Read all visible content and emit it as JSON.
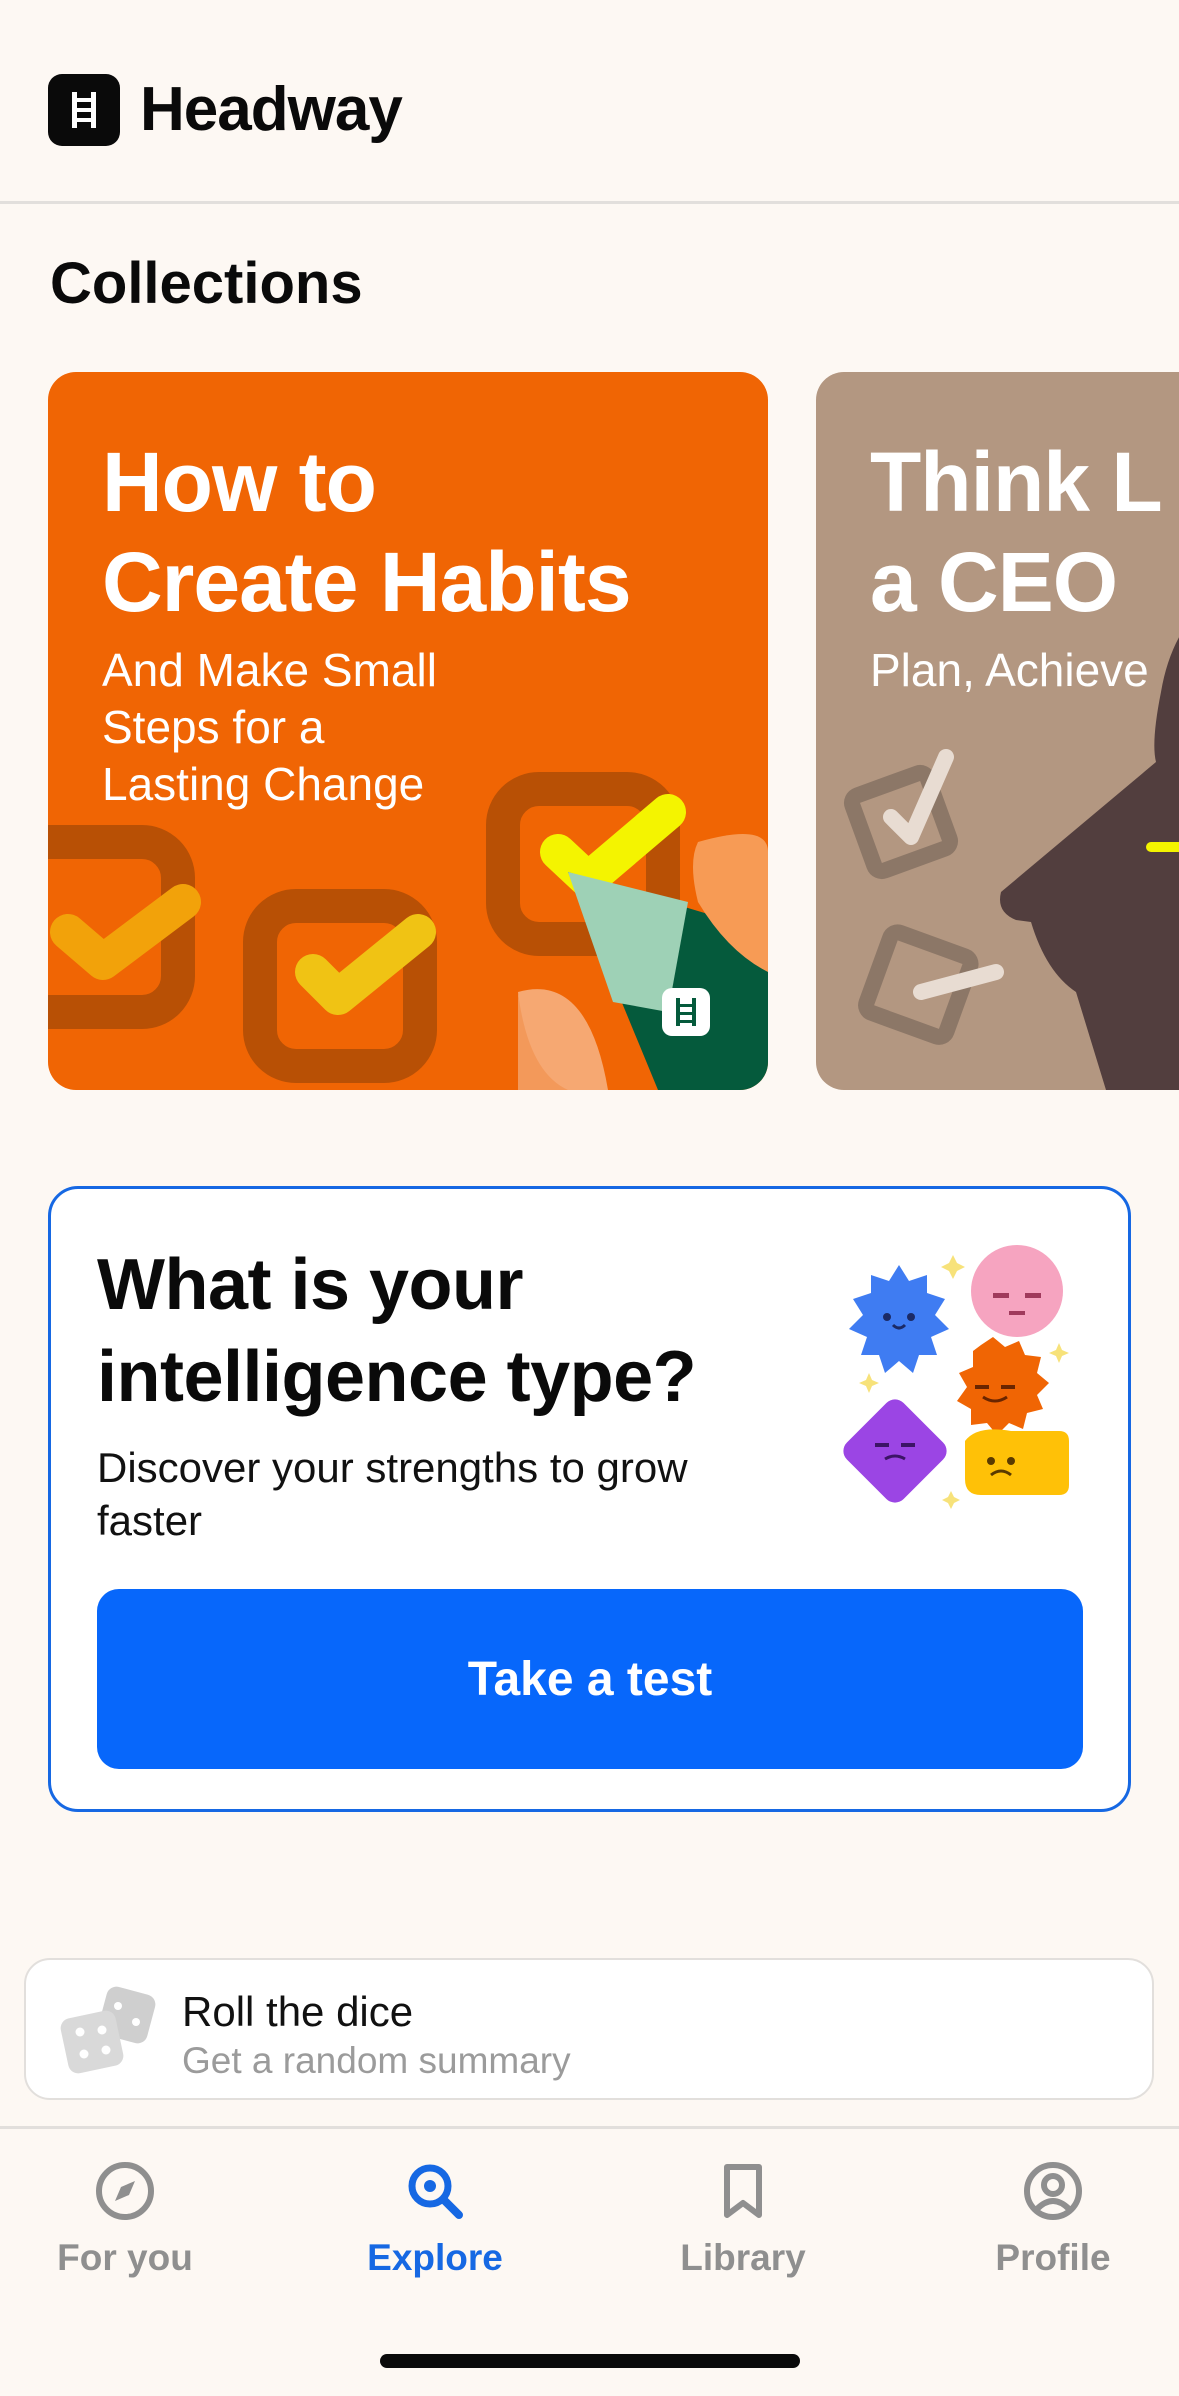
{
  "app": {
    "name": "Headway"
  },
  "collections": {
    "title": "Collections",
    "cards": [
      {
        "title": "How to\nCreate Habits",
        "subtitle": "And Make Small\nSteps for a\nLasting Change"
      },
      {
        "title": "Think L\na CEO",
        "subtitle": "Plan, Achieve"
      }
    ]
  },
  "quiz": {
    "title": "What is your\nintelligence type?",
    "subtitle": "Discover your strengths to grow faster",
    "button_label": "Take a test"
  },
  "dice": {
    "title": "Roll the dice",
    "subtitle": "Get a random summary"
  },
  "tabbar": {
    "items": [
      {
        "label": "For you",
        "icon": "compass-icon"
      },
      {
        "label": "Explore",
        "icon": "search-icon",
        "active": true
      },
      {
        "label": "Library",
        "icon": "bookmark-icon"
      },
      {
        "label": "Profile",
        "icon": "profile-icon"
      }
    ]
  },
  "colors": {
    "background": "#fdf8f3",
    "accent": "#0767fb",
    "card_orange": "#f06504",
    "card_tan": "#b39781",
    "inactive_tab": "#8f8f8f"
  }
}
